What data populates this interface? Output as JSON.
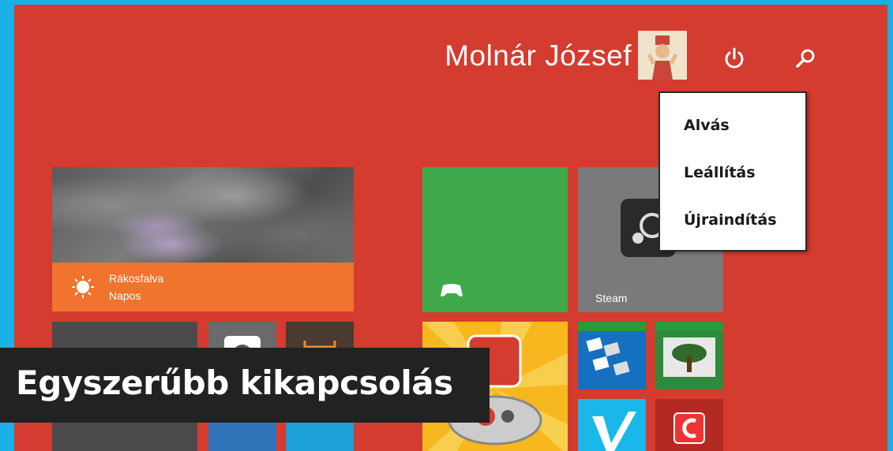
{
  "header": {
    "user_name": "Molnár József",
    "avatar_icon": "user-avatar",
    "power_icon": "power-icon",
    "search_icon": "search-icon"
  },
  "power_menu": {
    "items": [
      {
        "label": "Alvás"
      },
      {
        "label": "Leállítás"
      },
      {
        "label": "Újraindítás"
      }
    ]
  },
  "tiles": {
    "weather": {
      "city": "Rákosfalva",
      "condition": "Napos",
      "icon": "sun-icon",
      "color": "#f0732e"
    },
    "xbox": {
      "icon": "gamepad-icon",
      "color": "#3ea84a"
    },
    "steam": {
      "label": "Steam",
      "icon": "steam-icon",
      "color": "#7a7a7a"
    }
  },
  "caption": {
    "text": "Egyszerűbb kikapcsolás"
  },
  "colors": {
    "background": "#d33c2f",
    "frame": "#1ab0e6"
  }
}
